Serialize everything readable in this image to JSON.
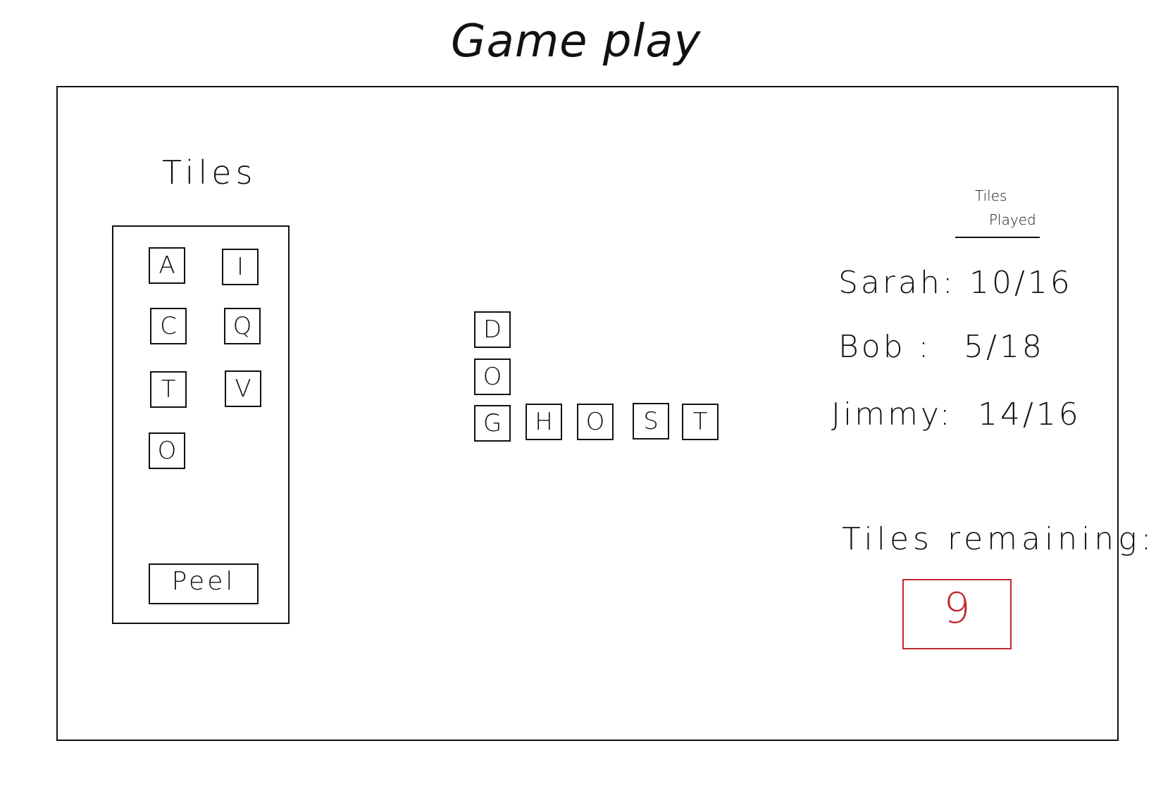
{
  "title": "Game play",
  "rack": {
    "heading": "Tiles",
    "tiles": [
      "A",
      "I",
      "C",
      "Q",
      "T",
      "V",
      "O"
    ],
    "peel_label": "Peel"
  },
  "board": {
    "tiles": [
      "D",
      "O",
      "G",
      "H",
      "O",
      "S",
      "T"
    ]
  },
  "scoreboard": {
    "header_line1": "Tiles",
    "header_line2": "Played",
    "players": [
      {
        "name": "Sarah:",
        "score": "10/16"
      },
      {
        "name": "Bob :",
        "score": "5/18"
      },
      {
        "name": "Jimmy:",
        "score": "14/16"
      }
    ]
  },
  "remaining": {
    "label": "Tiles remaining:",
    "value": "9",
    "color": "#c0282d"
  }
}
